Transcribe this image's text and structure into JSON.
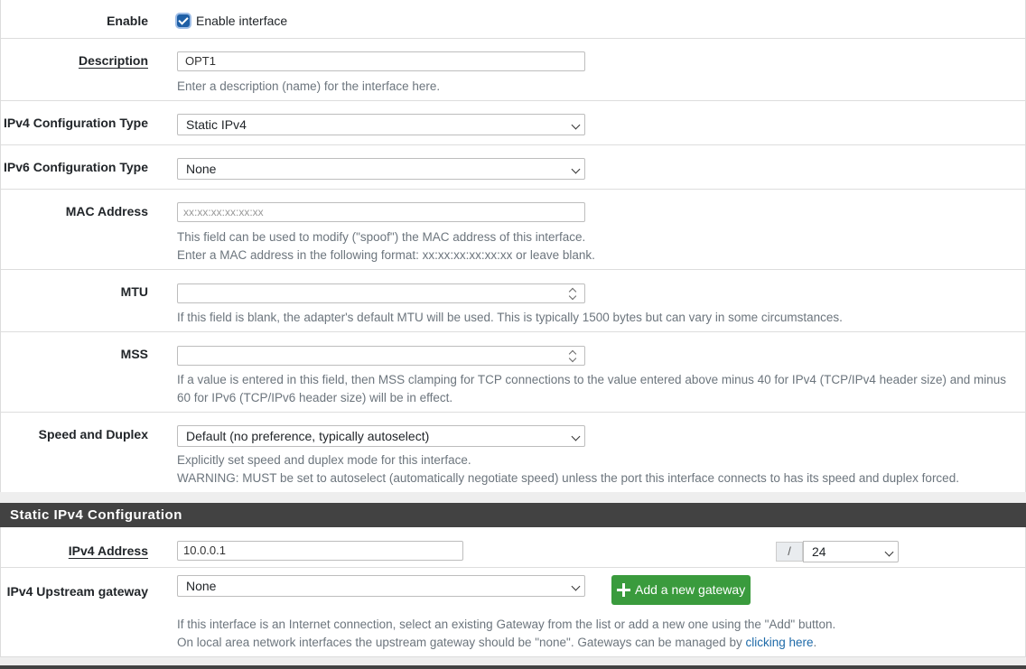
{
  "general": {
    "enable": {
      "label": "Enable",
      "checkbox_label": "Enable interface",
      "checked": true
    },
    "description": {
      "label": "Description",
      "value": "OPT1",
      "help": "Enter a description (name) for the interface here."
    },
    "ipv4_type": {
      "label": "IPv4 Configuration Type",
      "value": "Static IPv4"
    },
    "ipv6_type": {
      "label": "IPv6 Configuration Type",
      "value": "None"
    },
    "mac": {
      "label": "MAC Address",
      "placeholder": "xx:xx:xx:xx:xx:xx",
      "help1": "This field can be used to modify (\"spoof\") the MAC address of this interface.",
      "help2": "Enter a MAC address in the following format: xx:xx:xx:xx:xx:xx or leave blank."
    },
    "mtu": {
      "label": "MTU",
      "help": "If this field is blank, the adapter's default MTU will be used. This is typically 1500 bytes but can vary in some circumstances."
    },
    "mss": {
      "label": "MSS",
      "help1": "If a value is entered in this field, then MSS clamping for TCP connections to the value entered above minus 40 for IPv4 (TCP/IPv4 header size) and minus",
      "help2": "60 for IPv6 (TCP/IPv6 header size) will be in effect."
    },
    "speed": {
      "label": "Speed and Duplex",
      "value": "Default (no preference, typically autoselect)",
      "help1": "Explicitly set speed and duplex mode for this interface.",
      "help2": "WARNING: MUST be set to autoselect (automatically negotiate speed) unless the port this interface connects to has its speed and duplex forced."
    }
  },
  "static_ipv4": {
    "header": "Static IPv4 Configuration",
    "address": {
      "label": "IPv4 Address",
      "value": "10.0.0.1",
      "slash": "/",
      "cidr": "24"
    },
    "gateway": {
      "label": "IPv4 Upstream gateway",
      "value": "None",
      "add_button": "Add a new gateway",
      "help1": "If this interface is an Internet connection, select an existing Gateway from the list or add a new one using the \"Add\" button.",
      "help2_prefix": "On local area network interfaces the upstream gateway should be \"none\". Gateways can be managed by ",
      "help2_link": "clicking here",
      "help2_suffix": "."
    }
  }
}
